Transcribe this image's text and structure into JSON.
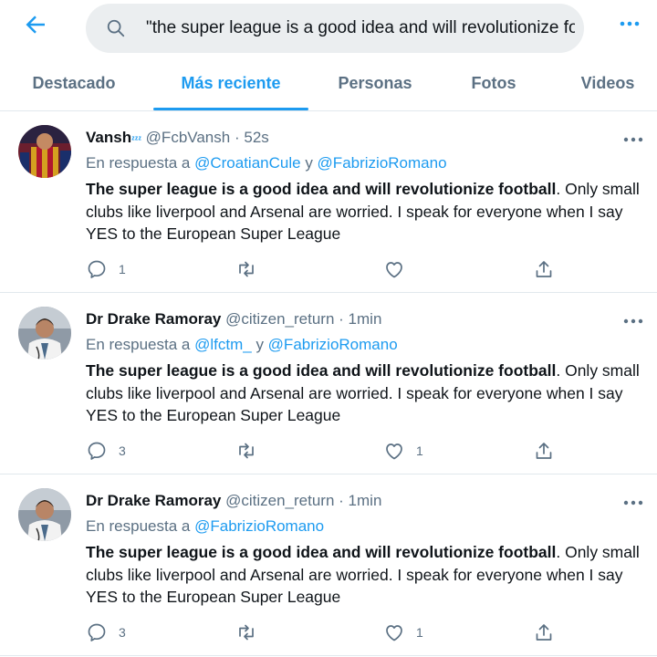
{
  "search": {
    "query": "\"the super league is a good idea and will revolutionize foc"
  },
  "tabs": [
    {
      "label": "Destacado",
      "active": false
    },
    {
      "label": "Más reciente",
      "active": true
    },
    {
      "label": "Personas",
      "active": false
    },
    {
      "label": "Fotos",
      "active": false
    },
    {
      "label": "Videos",
      "active": false
    }
  ],
  "tweets": [
    {
      "name": "Vansh",
      "name_suffix": "ᶻᶻᶻ",
      "handle": "@FcbVansh",
      "separator": "·",
      "time": "52s",
      "reply_prefix": "En respuesta a",
      "reply_to": [
        "@CroatianCule",
        "@FabrizioRomano"
      ],
      "reply_joiner": "y",
      "text_bold": "The super league is a good idea and will revolutionize football",
      "text_rest": ". Only small clubs like liverpool and Arsenal are worried. I speak for everyone when I say YES to the European Super League",
      "reply_count": "1",
      "like_count": ""
    },
    {
      "name": "Dr Drake Ramoray",
      "name_suffix": "",
      "handle": "@citizen_return",
      "separator": "·",
      "time": "1min",
      "reply_prefix": "En respuesta a",
      "reply_to": [
        "@lfctm_",
        "@FabrizioRomano"
      ],
      "reply_joiner": "y",
      "text_bold": "The super league is a good idea and will revolutionize football",
      "text_rest": ". Only small clubs like liverpool and Arsenal are worried. I speak for everyone when I say YES to the European Super League",
      "reply_count": "3",
      "like_count": "1"
    },
    {
      "name": "Dr Drake Ramoray",
      "name_suffix": "",
      "handle": "@citizen_return",
      "separator": "·",
      "time": "1min",
      "reply_prefix": "En respuesta a",
      "reply_to": [
        "@FabrizioRomano",
        ""
      ],
      "reply_joiner": "",
      "text_bold": "The super league is a good idea and will revolutionize football",
      "text_rest": ". Only small clubs like liverpool and Arsenal are worried. I speak for everyone when I say YES to the European Super League",
      "reply_count": "3",
      "like_count": "1"
    }
  ],
  "colors": {
    "accent": "#1d9bf0",
    "secondary_text": "#5b7083",
    "divider": "#e1e8ed",
    "search_bg": "#ebeef0"
  },
  "icons": [
    "back-arrow-icon",
    "search-icon",
    "more-icon",
    "reply-icon",
    "retweet-icon",
    "like-icon",
    "share-icon"
  ]
}
